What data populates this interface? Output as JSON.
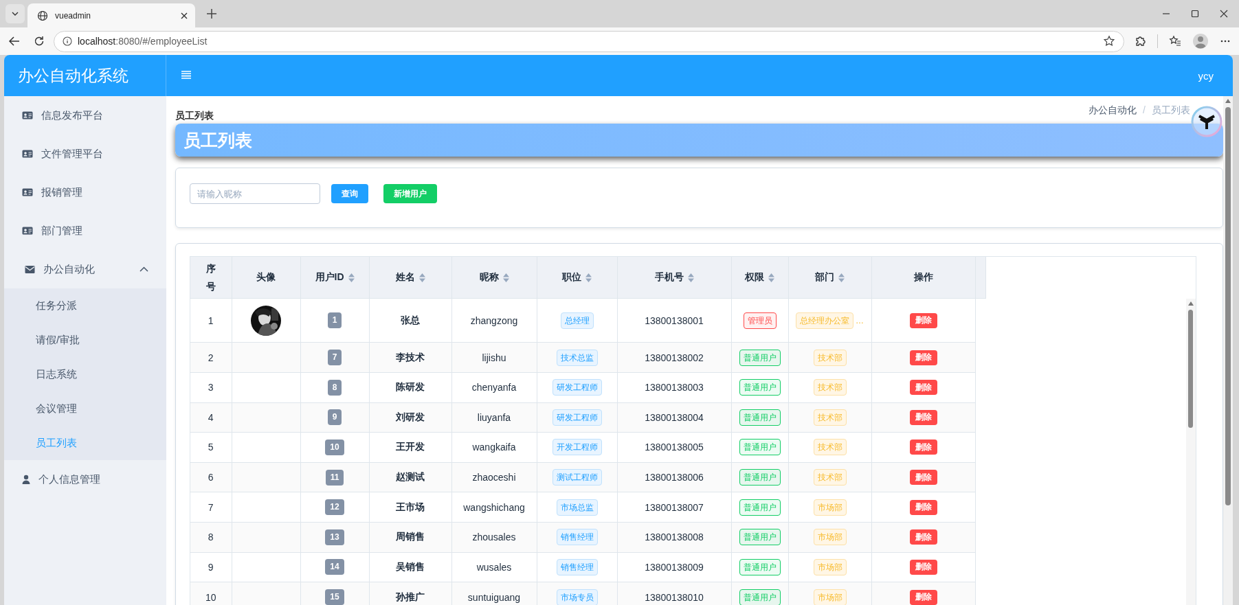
{
  "browser": {
    "tab_title": "vueadmin",
    "url_host": "localhost",
    "url_path": ":8080/#/employeeList"
  },
  "header": {
    "title": "办公自动化系统",
    "user": "ycy"
  },
  "sidebar": {
    "items": [
      {
        "label": "信息发布平台",
        "selected": false
      },
      {
        "label": "文件管理平台",
        "selected": false
      },
      {
        "label": "报销管理",
        "selected": false
      },
      {
        "label": "部门管理",
        "selected": false
      },
      {
        "label": "办公自动化",
        "expanded": true,
        "children": [
          {
            "label": "任务分派",
            "selected": false
          },
          {
            "label": "请假/审批",
            "selected": false
          },
          {
            "label": "日志系统",
            "selected": false
          },
          {
            "label": "会议管理",
            "selected": false
          },
          {
            "label": "员工列表",
            "selected": true
          }
        ]
      },
      {
        "label": "个人信息管理",
        "selected": false
      }
    ]
  },
  "page": {
    "title": "员工列表",
    "breadcrumb": [
      "办公自动化",
      "员工列表"
    ],
    "breadcrumb_separator": "/",
    "banner": "员工列表"
  },
  "search": {
    "placeholder": "请输入昵称",
    "buttons": [
      {
        "label": "查询",
        "kind": "primary"
      },
      {
        "label": "新增用户",
        "kind": "success"
      }
    ]
  },
  "table": {
    "columns": [
      {
        "label": "序号",
        "sortable": false
      },
      {
        "label": "头像",
        "sortable": false
      },
      {
        "label": "用户ID",
        "sortable": true
      },
      {
        "label": "姓名",
        "sortable": true
      },
      {
        "label": "昵称",
        "sortable": true
      },
      {
        "label": "职位",
        "sortable": true
      },
      {
        "label": "手机号",
        "sortable": true
      },
      {
        "label": "权限",
        "sortable": true
      },
      {
        "label": "部门",
        "sortable": true
      },
      {
        "label": "操作",
        "sortable": false
      }
    ],
    "rows": [
      {
        "index": "1",
        "avatar": true,
        "user_id": "1",
        "name": "张总",
        "nickname": "zhangzong",
        "position": "总经理",
        "phone": "13800138001",
        "role": {
          "label": "管理员",
          "color": "#ff4949"
        },
        "dept": "总经理办公室",
        "dept_more": "…",
        "action": "删除"
      },
      {
        "index": "2",
        "avatar": false,
        "user_id": "7",
        "name": "李技术",
        "nickname": "lijishu",
        "position": "技术总监",
        "phone": "13800138002",
        "role": {
          "label": "普通用户",
          "color": "#13ce66"
        },
        "dept": "技术部",
        "action": "删除"
      },
      {
        "index": "3",
        "avatar": false,
        "user_id": "8",
        "name": "陈研发",
        "nickname": "chenyanfa",
        "position": "研发工程师",
        "phone": "13800138003",
        "role": {
          "label": "普通用户",
          "color": "#13ce66"
        },
        "dept": "技术部",
        "action": "删除"
      },
      {
        "index": "4",
        "avatar": false,
        "user_id": "9",
        "name": "刘研发",
        "nickname": "liuyanfa",
        "position": "研发工程师",
        "phone": "13800138004",
        "role": {
          "label": "普通用户",
          "color": "#13ce66"
        },
        "dept": "技术部",
        "action": "删除"
      },
      {
        "index": "5",
        "avatar": false,
        "user_id": "10",
        "name": "王开发",
        "nickname": "wangkaifa",
        "position": "开发工程师",
        "phone": "13800138005",
        "role": {
          "label": "普通用户",
          "color": "#13ce66"
        },
        "dept": "技术部",
        "action": "删除"
      },
      {
        "index": "6",
        "avatar": false,
        "user_id": "11",
        "name": "赵测试",
        "nickname": "zhaoceshi",
        "position": "测试工程师",
        "phone": "13800138006",
        "role": {
          "label": "普通用户",
          "color": "#13ce66"
        },
        "dept": "技术部",
        "action": "删除"
      },
      {
        "index": "7",
        "avatar": false,
        "user_id": "12",
        "name": "王市场",
        "nickname": "wangshichang",
        "position": "市场总监",
        "phone": "13800138007",
        "role": {
          "label": "普通用户",
          "color": "#13ce66"
        },
        "dept": "市场部",
        "action": "删除"
      },
      {
        "index": "8",
        "avatar": false,
        "user_id": "13",
        "name": "周销售",
        "nickname": "zhousales",
        "position": "销售经理",
        "phone": "13800138008",
        "role": {
          "label": "普通用户",
          "color": "#13ce66"
        },
        "dept": "市场部",
        "action": "删除"
      },
      {
        "index": "9",
        "avatar": false,
        "user_id": "14",
        "name": "吴销售",
        "nickname": "wusales",
        "position": "销售经理",
        "phone": "13800138009",
        "role": {
          "label": "普通用户",
          "color": "#13ce66"
        },
        "dept": "市场部",
        "action": "删除"
      },
      {
        "index": "10",
        "avatar": false,
        "user_id": "15",
        "name": "孙推广",
        "nickname": "suntuiguang",
        "position": "市场专员",
        "phone": "13800138010",
        "role": {
          "label": "普通用户",
          "color": "#13ce66"
        },
        "dept": "市场部",
        "action": "删除"
      }
    ]
  }
}
